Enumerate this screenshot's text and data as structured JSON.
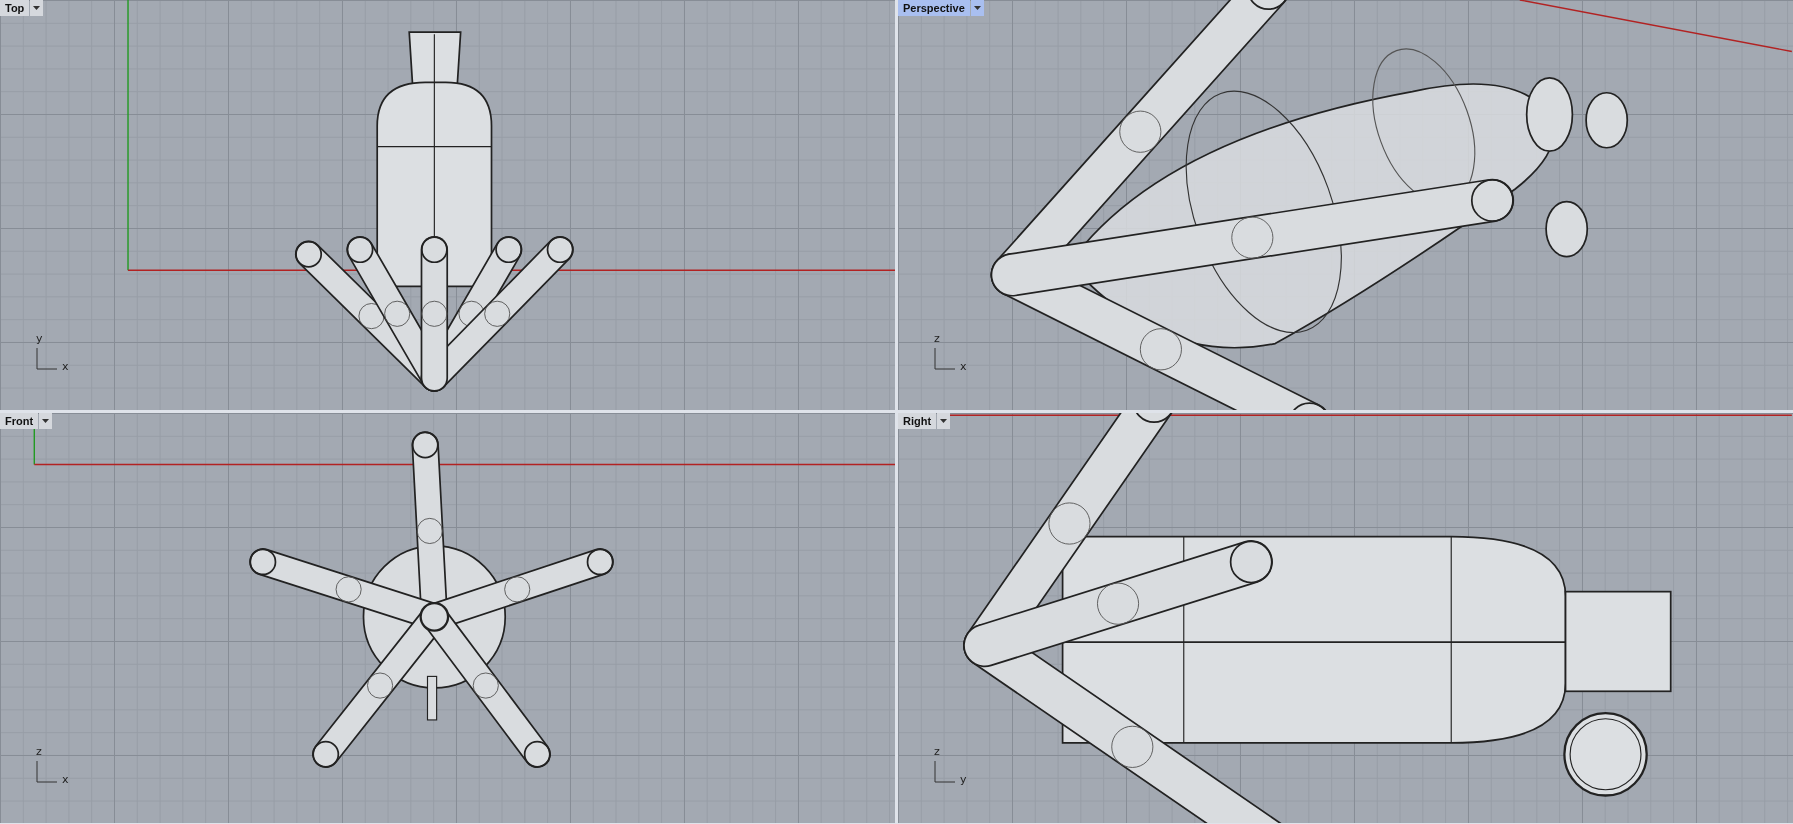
{
  "viewports": [
    {
      "kind": "top",
      "title": "Top",
      "selected": false,
      "axis_labels": [
        "y",
        "x"
      ]
    },
    {
      "kind": "perspective",
      "title": "Perspective",
      "selected": true,
      "axis_labels": [
        "z",
        "x"
      ]
    },
    {
      "kind": "front",
      "title": "Front",
      "selected": false,
      "axis_labels": [
        "z",
        "x"
      ]
    },
    {
      "kind": "right",
      "title": "Right",
      "selected": false,
      "axis_labels": [
        "z",
        "y"
      ]
    }
  ]
}
